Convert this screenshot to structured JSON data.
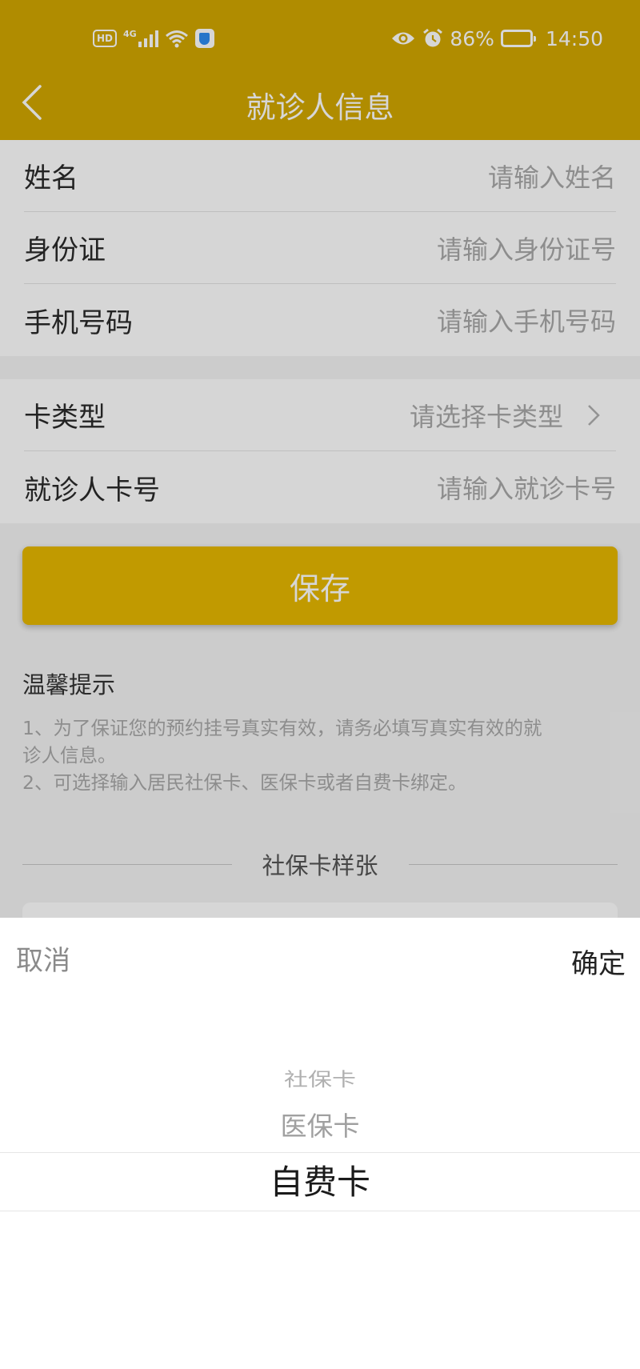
{
  "status_bar": {
    "hd": "HD",
    "network": "4G",
    "battery": "86%",
    "battery_level": 0.86,
    "time": "14:50"
  },
  "nav": {
    "title": "就诊人信息"
  },
  "form": {
    "name": {
      "label": "姓名",
      "placeholder": "请输入姓名"
    },
    "id_card": {
      "label": "身份证",
      "placeholder": "请输入身份证号"
    },
    "phone": {
      "label": "手机号码",
      "placeholder": "请输入手机号码"
    },
    "card_type": {
      "label": "卡类型",
      "placeholder": "请选择卡类型"
    },
    "card_no": {
      "label": "就诊人卡号",
      "placeholder": "请输入就诊卡号"
    }
  },
  "save_label": "保存",
  "tips": {
    "title": "温馨提示",
    "line1": "1、为了保证您的预约挂号真实有效，请务必填写真实有效的就",
    "line2": "诊人信息。",
    "line3": "2、可选择输入居民社保卡、医保卡或者自费卡绑定。"
  },
  "sample": {
    "title": "社保卡样张"
  },
  "picker": {
    "cancel": "取消",
    "confirm": "确定",
    "options": [
      "社保卡",
      "医保卡",
      "自费卡"
    ],
    "selected": "自费卡"
  },
  "colors": {
    "header": "#d2a700",
    "button": "#e6b800"
  },
  "icons": [
    "back-icon",
    "chevron-right-icon",
    "signal-icon",
    "wifi-icon",
    "shield-icon",
    "eye-icon",
    "alarm-icon",
    "battery-icon"
  ]
}
